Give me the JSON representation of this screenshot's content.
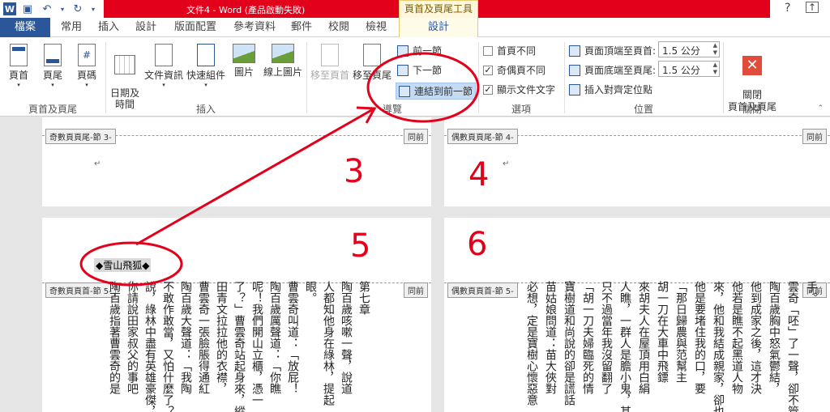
{
  "window": {
    "title": "文件4 - Word (產品啟動失敗)",
    "tools_tab": "頁首及頁尾工具",
    "help": "?",
    "restore": "⧉"
  },
  "tabs": [
    "檔案",
    "常用",
    "插入",
    "設計",
    "版面配置",
    "參考資料",
    "郵件",
    "校閱",
    "檢視",
    "設計"
  ],
  "ribbon": {
    "header_footer_group": {
      "label": "頁首及頁尾",
      "buttons": [
        "頁首",
        "頁尾",
        "頁碼"
      ]
    },
    "insert_group": {
      "label": "插入",
      "buttons": [
        "日期及\n時間",
        "文件資訊",
        "快速組件",
        "圖片",
        "線上圖片"
      ]
    },
    "nav_group": {
      "label": "導覽",
      "goto_header": "移至頁首",
      "goto_footer": "移至頁尾",
      "prev": "前一節",
      "next": "下一節",
      "link_prev": "連結到前一節"
    },
    "options_group": {
      "label": "選項",
      "diff_first": "首頁不同",
      "diff_odd_even": "奇偶頁不同",
      "show_doc_text": "顯示文件文字"
    },
    "position_group": {
      "label": "位置",
      "header_from_top": "頁面頂端至頁首:",
      "header_value": "1.5 公分",
      "footer_from_bottom": "頁面底端至頁尾:",
      "footer_value": "1.5 公分",
      "insert_align_tab": "插入對齊定位點"
    },
    "close_group": {
      "label": "關閉",
      "close_button": "關閉\n頁首及頁尾"
    }
  },
  "pages": {
    "odd_footer_tag": "奇數頁頁尾-節 3-",
    "even_footer_tag": "偶數頁頁尾-節 4-",
    "odd_header_tag": "奇數頁頁首-節 5-",
    "even_header_tag": "偶數頁頁首-節 5-",
    "same_as_prev": "同前",
    "header_field_text": "◆雪山飛狐◆",
    "para_mark": "↵"
  },
  "annotations": {
    "n3": "3",
    "n4": "4",
    "n5": "5",
    "n6": "6"
  },
  "left_page_columns": [
    "第七章",
    "陶百歲咳嗽一聲，說道",
    "人都知他身在綠林，提起",
    "眼。",
    "曹雲奇叫道：「放屁！",
    "陶百歲厲聲道：「你瞧",
    "呢！我們開山立櫃，憑一",
    "了？」曹雲奇站起身來，縱",
    "田青文拉拉他的衣襟，",
    "曹雲奇一張臉脹得通紅",
    "陶百歲大聲道：「我陶",
    "不敢作敢當，又怕什麼了？",
    "說，綠林中盡有英雄豪傑，",
    "你請說田家叔父的事吧",
    "陶百歲指著曹雲奇的是"
  ],
  "right_page_columns": [
    "手。",
    "雲奇「呸」了一聲，卻不管",
    "陶百歲胸中怒氣鬱結，",
    "他到成家之後，這才決",
    "他若是瞧不起黑道人物",
    "來，他和我結成親家，卻也",
    "他是要堵住我的口，要",
    "「那日歸農與范幫主",
    "胡一刀在大車中飛鏢",
    "來胡夫人在屋頂用白絹",
    "人瞧，一群人是膽小鬼，甚",
    "只不過當年我沒留翻了",
    "「胡一刀夫婦臨死的情",
    "寶樹道和尚說的卻是謊話",
    "苗姑娘問道：苗大俠對",
    "必想，定是寶樹心懷惡意"
  ]
}
